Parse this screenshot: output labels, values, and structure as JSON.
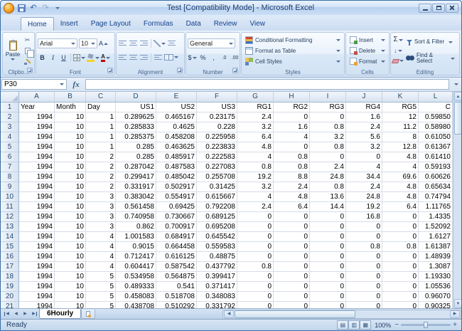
{
  "titlebar": {
    "title": "Test [Compatibility Mode] - Microsoft Excel"
  },
  "icons": {
    "cut": "✂",
    "undo": "↶",
    "redo": "↷",
    "fill": "↓",
    "scroll_up": "▲",
    "scroll_down": "▼",
    "scroll_left": "◀",
    "scroll_right": "▶",
    "tab_first": "◀",
    "tab_prev": "◀",
    "tab_next": "▶",
    "tab_last": "▶",
    "view_normal": "▤",
    "view_page_layout": "▥",
    "view_page_break": "▦",
    "zoom_out": "−",
    "zoom_in": "+"
  },
  "ribbon": {
    "tabs": [
      "Home",
      "Insert",
      "Page Layout",
      "Formulas",
      "Data",
      "Review",
      "View"
    ],
    "active_tab": "Home",
    "clipboard": {
      "label": "Clipbo...",
      "paste_label": "Paste"
    },
    "font": {
      "label": "Font",
      "font_name": "Arial",
      "font_size": "10",
      "bold": "B",
      "italic": "I",
      "underline": "U",
      "grow": "A",
      "shrink": "A",
      "color_letter": "A"
    },
    "alignment": {
      "label": "Alignment"
    },
    "number": {
      "label": "Number",
      "format": "General",
      "currency": "$",
      "percent": "%",
      "comma": ",",
      "inc_decimal": ".0",
      "dec_decimal": ".00"
    },
    "styles": {
      "label": "Styles",
      "conditional_formatting": "Conditional Formatting",
      "format_as_table": "Format as Table",
      "cell_styles": "Cell Styles"
    },
    "cells": {
      "label": "Cells",
      "insert": "Insert",
      "delete": "Delete",
      "format": "Format"
    },
    "editing": {
      "label": "Editing",
      "autosum": "Σ",
      "sort_filter": "Sort & Filter",
      "find_select": "Find & Select"
    }
  },
  "formula_bar": {
    "name_box": "P30",
    "fx": "fx",
    "formula": ""
  },
  "grid": {
    "col_headers": [
      "A",
      "B",
      "C",
      "D",
      "E",
      "F",
      "G",
      "H",
      "I",
      "J",
      "K",
      "L"
    ],
    "rows": [
      [
        "Year",
        "Month",
        "Day",
        "US1",
        "US2",
        "US3",
        "RG1",
        "RG2",
        "RG3",
        "RG4",
        "RG5",
        "C"
      ],
      [
        "1994",
        "10",
        "1",
        "0.289625",
        "0.465167",
        "0.23175",
        "2.4",
        "0",
        "0",
        "1.6",
        "12",
        "0.59850"
      ],
      [
        "1994",
        "10",
        "1",
        "0.285833",
        "0.4625",
        "0.228",
        "3.2",
        "1.6",
        "0.8",
        "2.4",
        "11.2",
        "0.58980"
      ],
      [
        "1994",
        "10",
        "1",
        "0.285375",
        "0.458208",
        "0.225958",
        "6.4",
        "4",
        "3.2",
        "5.6",
        "8",
        "0.61050"
      ],
      [
        "1994",
        "10",
        "1",
        "0.285",
        "0.463625",
        "0.223833",
        "4.8",
        "0",
        "0.8",
        "3.2",
        "12.8",
        "0.61367"
      ],
      [
        "1994",
        "10",
        "2",
        "0.285",
        "0.485917",
        "0.222583",
        "4",
        "0.8",
        "0",
        "0",
        "4.8",
        "0.61410"
      ],
      [
        "1994",
        "10",
        "2",
        "0.287042",
        "0.487583",
        "0.227083",
        "0.8",
        "0.8",
        "2.4",
        "4",
        "4",
        "0.59193"
      ],
      [
        "1994",
        "10",
        "2",
        "0.299417",
        "0.485042",
        "0.255708",
        "19.2",
        "8.8",
        "24.8",
        "34.4",
        "69.6",
        "0.60626"
      ],
      [
        "1994",
        "10",
        "2",
        "0.331917",
        "0.502917",
        "0.31425",
        "3.2",
        "2.4",
        "0.8",
        "2.4",
        "4.8",
        "0.65634"
      ],
      [
        "1994",
        "10",
        "3",
        "0.383042",
        "0.554917",
        "0.615667",
        "4",
        "4.8",
        "13.6",
        "24.8",
        "4.8",
        "0.74794"
      ],
      [
        "1994",
        "10",
        "3",
        "0.561458",
        "0.69425",
        "0.792208",
        "2.4",
        "6.4",
        "14.4",
        "19.2",
        "6.4",
        "1.11765"
      ],
      [
        "1994",
        "10",
        "3",
        "0.740958",
        "0.730667",
        "0.689125",
        "0",
        "0",
        "0",
        "16.8",
        "0",
        "1.4335"
      ],
      [
        "1994",
        "10",
        "3",
        "0.862",
        "0.700917",
        "0.695208",
        "0",
        "0",
        "0",
        "0",
        "0",
        "1.52092"
      ],
      [
        "1994",
        "10",
        "4",
        "1.001583",
        "0.684917",
        "0.645542",
        "0",
        "0",
        "0",
        "0",
        "0",
        "1.6127"
      ],
      [
        "1994",
        "10",
        "4",
        "0.9015",
        "0.664458",
        "0.559583",
        "0",
        "0",
        "0",
        "0.8",
        "0.8",
        "1.61387"
      ],
      [
        "1994",
        "10",
        "4",
        "0.712417",
        "0.616125",
        "0.48875",
        "0",
        "0",
        "0",
        "0",
        "0",
        "1.48939"
      ],
      [
        "1994",
        "10",
        "4",
        "0.604417",
        "0.587542",
        "0.437792",
        "0.8",
        "0",
        "0",
        "0",
        "0",
        "1.3087"
      ],
      [
        "1994",
        "10",
        "5",
        "0.534958",
        "0.564875",
        "0.399417",
        "0",
        "0",
        "0",
        "0",
        "0",
        "1.19330"
      ],
      [
        "1994",
        "10",
        "5",
        "0.489333",
        "0.541",
        "0.371417",
        "0",
        "0",
        "0",
        "0",
        "0",
        "1.05536"
      ],
      [
        "1994",
        "10",
        "5",
        "0.458083",
        "0.518708",
        "0.348083",
        "0",
        "0",
        "0",
        "0",
        "0",
        "0.96070"
      ],
      [
        "1994",
        "10",
        "5",
        "0.438708",
        "0.510292",
        "0.331792",
        "0",
        "0",
        "0",
        "0",
        "0",
        "0.90325"
      ]
    ]
  },
  "sheet_tabs": {
    "active": "6Hourly"
  },
  "status_bar": {
    "mode": "Ready",
    "zoom": "100%"
  }
}
